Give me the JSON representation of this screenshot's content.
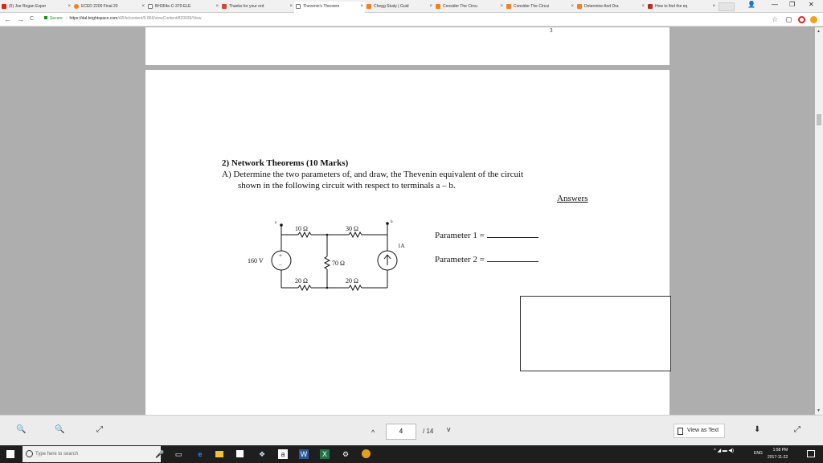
{
  "browser": {
    "tabs": [
      {
        "label": "(5) Joe Rogan Exper",
        "color": "#e62117"
      },
      {
        "label": "ECED 2200 Final 20",
        "color": "#f4801f"
      },
      {
        "label": "BH364e-C-370-ELE",
        "color": "#777777"
      },
      {
        "label": "Thanks for your ord",
        "color": "#d44638"
      },
      {
        "label": "Thevenin's Theorem",
        "color": "#777777"
      },
      {
        "label": "Chegg Study | Guid",
        "color": "#f4801f"
      },
      {
        "label": "Consider The Circu",
        "color": "#f4801f"
      },
      {
        "label": "Consider The Circui",
        "color": "#f4801f"
      },
      {
        "label": "Determine And Dra",
        "color": "#f4801f"
      },
      {
        "label": "How to find the eq",
        "color": "#b92b27"
      }
    ],
    "window_controls": {
      "profile": "👤",
      "min": "—",
      "max": "❐",
      "close": "✕"
    },
    "nav": {
      "back": "←",
      "forward": "→",
      "reload": "C"
    },
    "url": {
      "secure_label": "Secure",
      "host": "https://dal.brightspace.com",
      "path": "/d2l/le/content/5 866/viewContent/820939/View"
    },
    "star": "☆"
  },
  "document": {
    "prev_page_number": "3",
    "question_title": "2) Network Theorems (10 Marks)",
    "question_line1": "A)  Determine the two parameters of, and draw, the Thevenin equivalent of the circuit",
    "question_line2": "shown in the following circuit with respect to terminals a – b.",
    "answers_label": "Answers",
    "parameter1_label": "Parameter 1 =",
    "parameter2_label": "Parameter 2 =",
    "circuit": {
      "terminal_a": "a",
      "terminal_b": "b",
      "r_top_left": "10 Ω",
      "r_top_right": "30 Ω",
      "r_middle": "70 Ω",
      "r_bottom_left": "20 Ω",
      "r_bottom_right": "20 Ω",
      "voltage_source": "160 V",
      "current_source": "1A",
      "plus_sign": "+",
      "minus_sign": "−"
    }
  },
  "viewer_toolbar": {
    "zoom_out": "−",
    "zoom_in": "+",
    "fit": "⤢",
    "prev_page": "^",
    "page_current": "4",
    "page_total": "/ 14",
    "next_page": "v",
    "view_as_text": "View as Text",
    "download": "⬇",
    "fullscreen": "⤢"
  },
  "taskbar": {
    "search_placeholder": "Type here to search",
    "tray_lang": "ENG",
    "time": "1:58 PM",
    "date": "2017-11-22"
  }
}
